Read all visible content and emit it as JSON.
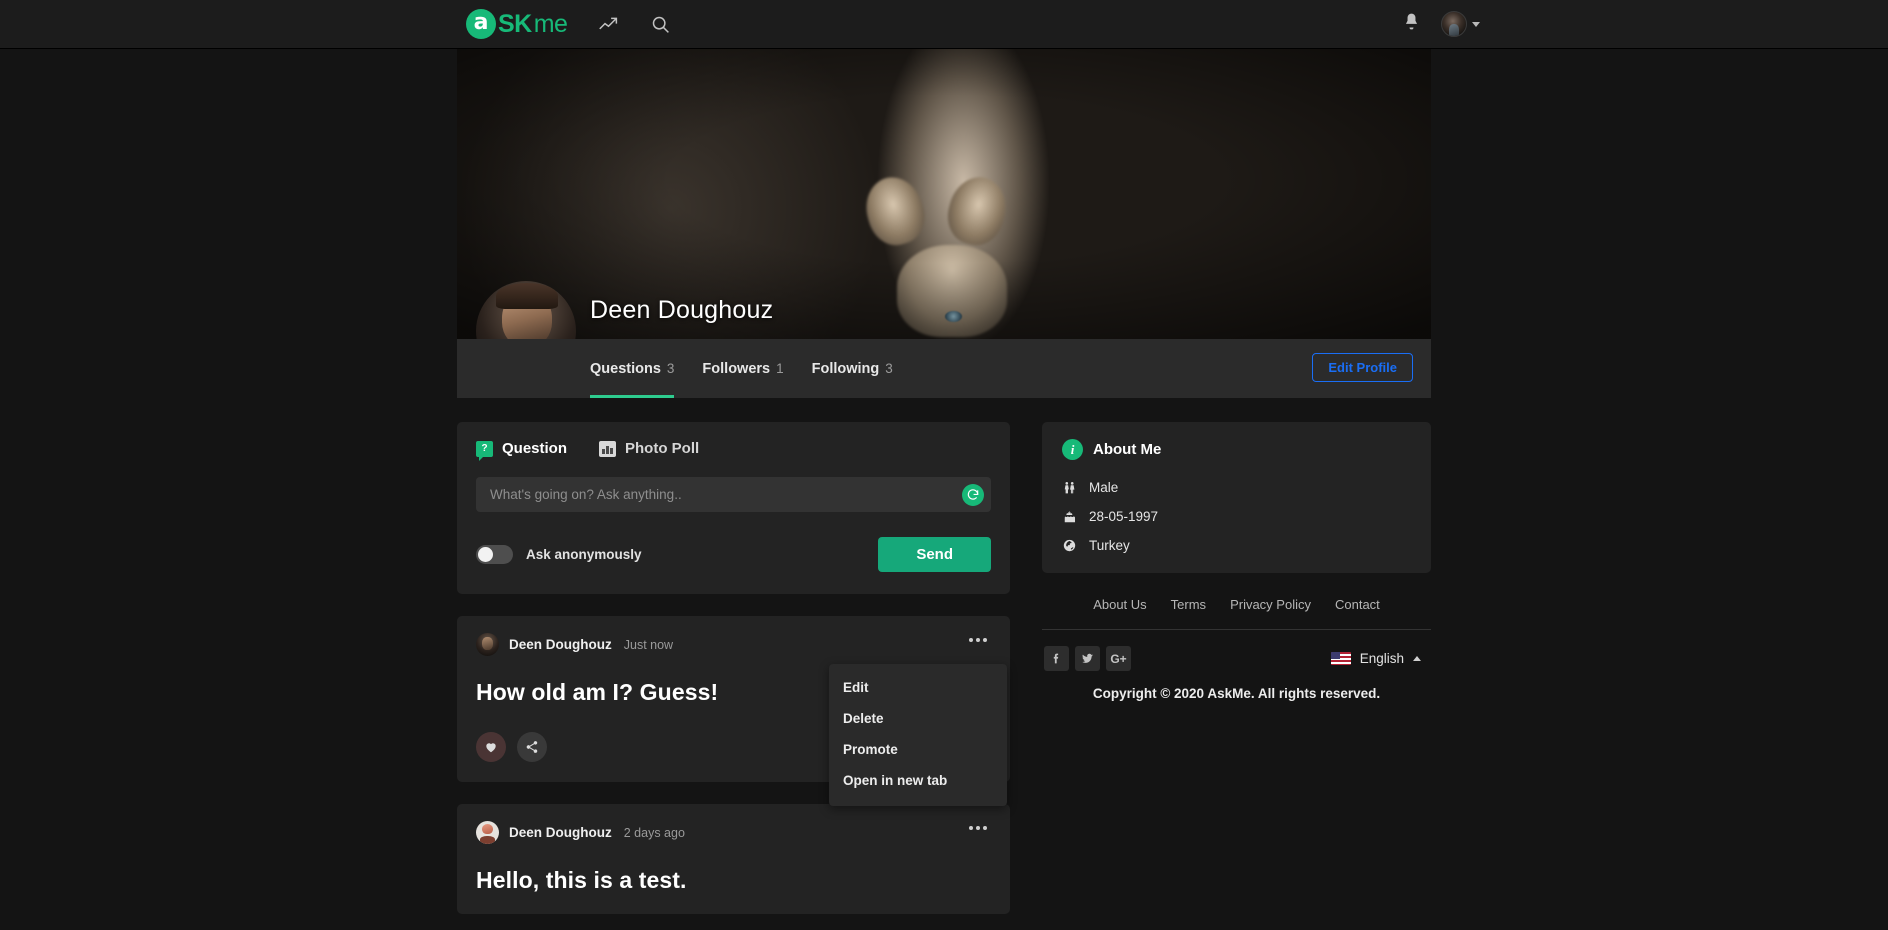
{
  "navbar": {
    "logo": {
      "mark": "a",
      "sk": "SK",
      "me": "me",
      "icon": "askme-logo-icon"
    },
    "trending_icon": "trending-up-icon",
    "search_icon": "search-icon",
    "notifications_icon": "bell-icon",
    "avatar_icon": "user-avatar",
    "caret_icon": "chevron-down-icon"
  },
  "profile": {
    "name": "Deen Doughouz",
    "cover_icon": "cover-photo",
    "avatar_icon": "profile-avatar",
    "tabs": [
      {
        "label": "Questions",
        "count": "3",
        "active": true
      },
      {
        "label": "Followers",
        "count": "1",
        "active": false
      },
      {
        "label": "Following",
        "count": "3",
        "active": false
      }
    ],
    "edit_profile_label": "Edit Profile"
  },
  "composer": {
    "tabs": [
      {
        "label": "Question",
        "icon": "question-bubble-icon",
        "active": true
      },
      {
        "label": "Photo Poll",
        "icon": "bar-chart-icon",
        "active": false
      }
    ],
    "input_value": "",
    "placeholder": "What's going on? Ask anything..",
    "refresh_icon": "refresh-icon",
    "anonymous_label": "Ask anonymously",
    "anonymous_on": false,
    "send_label": "Send"
  },
  "posts": [
    {
      "author": "Deen Doughouz",
      "time": "Just now",
      "title": "How old am I? Guess!",
      "avatar_style": "dark",
      "menu_icon": "more-horizontal-icon",
      "like_icon": "heart-icon",
      "share_icon": "share-icon",
      "menu_open": true,
      "menu_items": [
        "Edit",
        "Delete",
        "Promote",
        "Open in new tab"
      ]
    },
    {
      "author": "Deen Doughouz",
      "time": "2 days ago",
      "title": "Hello, this is a test.",
      "avatar_style": "light",
      "menu_icon": "more-horizontal-icon",
      "menu_open": false
    }
  ],
  "about": {
    "title": "About Me",
    "info_icon": "info-icon",
    "rows": [
      {
        "icon": "gender-icon",
        "value": "Male"
      },
      {
        "icon": "birthday-cake-icon",
        "value": "28-05-1997"
      },
      {
        "icon": "globe-icon",
        "value": "Turkey"
      }
    ]
  },
  "footer": {
    "links": [
      "About Us",
      "Terms",
      "Privacy Policy",
      "Contact"
    ],
    "socials": [
      {
        "name": "facebook-icon",
        "glyph": "f"
      },
      {
        "name": "twitter-icon",
        "glyph": "t"
      },
      {
        "name": "google-plus-icon",
        "glyph": "G+"
      }
    ],
    "language": "English",
    "language_flag": "us-flag-icon",
    "language_caret": "chevron-up-icon",
    "copyright": "Copyright © 2020 AskMe. All rights reserved."
  },
  "colors": {
    "brand_green": "#17b978",
    "accent_green": "#2ecc8f",
    "send_green": "#16a87a",
    "edit_blue": "#1a6ef5",
    "page_bg": "#141414",
    "card_bg": "#232323",
    "tabbar_bg": "#2b2b2b"
  }
}
